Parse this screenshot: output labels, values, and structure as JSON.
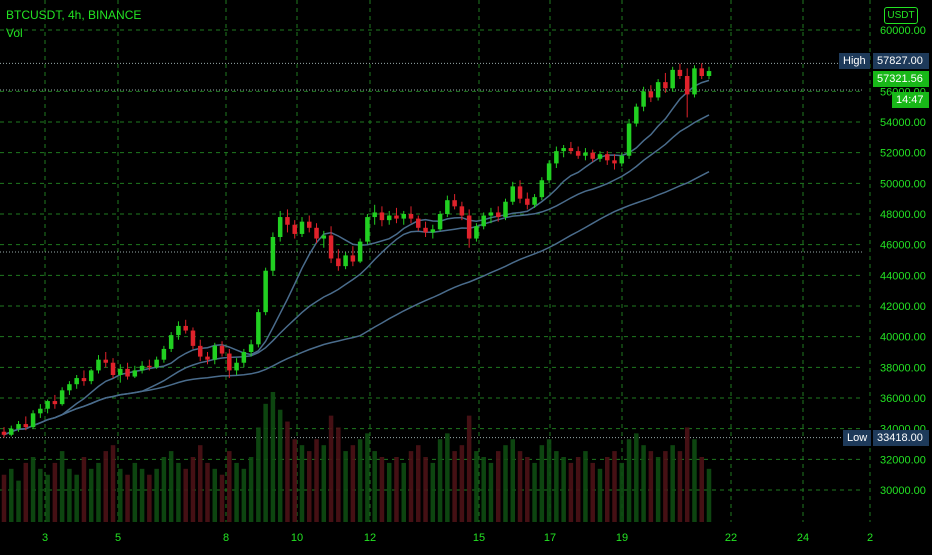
{
  "header": {
    "symbol_line": "BTCUSDT, 4h, BINANCE",
    "volume_label": "Vol"
  },
  "currency_button": "USDT",
  "labels": {
    "high_title": "High",
    "high_value": "57827.00",
    "last_price": "57321.56",
    "countdown": "14:47",
    "low_title": "Low",
    "low_value": "33418.00"
  },
  "colors": {
    "up": "#21d021",
    "down": "#e0222b",
    "ma": "#4a6c8c",
    "grid": "#1f7a1f",
    "text": "#23e323",
    "label_bg": "#1e3a5a",
    "price_bg": "#18b818"
  },
  "chart_data": {
    "type": "candlestick",
    "symbol": "BTCUSDT",
    "interval": "4h",
    "exchange": "BINANCE",
    "y_ticks": [
      "60000.00",
      "56000.00",
      "54000.00",
      "52000.00",
      "50000.00",
      "48000.00",
      "46000.00",
      "44000.00",
      "42000.00",
      "40000.00",
      "38000.00",
      "36000.00",
      "34000.00",
      "32000.00",
      "30000.00"
    ],
    "x_ticks": [
      "3",
      "5",
      "8",
      "10",
      "12",
      "15",
      "17",
      "19",
      "22",
      "24",
      "2"
    ],
    "ylim": [
      29000,
      61000
    ],
    "high": 57827.0,
    "low": 33418.0,
    "last": 57321.56,
    "ohlc": [
      [
        33800,
        34100,
        33420,
        33600
      ],
      [
        33600,
        34200,
        33500,
        34000
      ],
      [
        34000,
        34500,
        33800,
        34300
      ],
      [
        34300,
        34800,
        33900,
        34100
      ],
      [
        34100,
        35200,
        34000,
        35000
      ],
      [
        35000,
        35600,
        34700,
        35300
      ],
      [
        35300,
        35900,
        35000,
        35800
      ],
      [
        35800,
        36200,
        35300,
        35600
      ],
      [
        35600,
        36700,
        35500,
        36500
      ],
      [
        36500,
        37100,
        36200,
        36900
      ],
      [
        36900,
        37500,
        36600,
        37300
      ],
      [
        37300,
        37800,
        36800,
        37100
      ],
      [
        37100,
        37900,
        36900,
        37800
      ],
      [
        37800,
        38800,
        37600,
        38500
      ],
      [
        38500,
        39000,
        38000,
        38300
      ],
      [
        38300,
        38600,
        37300,
        37500
      ],
      [
        37500,
        38200,
        37000,
        37900
      ],
      [
        37900,
        38300,
        37200,
        37400
      ],
      [
        37400,
        38100,
        37300,
        37800
      ],
      [
        37800,
        38400,
        37600,
        38100
      ],
      [
        38100,
        38500,
        37800,
        38000
      ],
      [
        38000,
        38700,
        37900,
        38500
      ],
      [
        38500,
        39400,
        38300,
        39200
      ],
      [
        39200,
        40300,
        39000,
        40100
      ],
      [
        40100,
        41000,
        39800,
        40700
      ],
      [
        40700,
        41100,
        40200,
        40400
      ],
      [
        40400,
        40600,
        39200,
        39400
      ],
      [
        39400,
        39800,
        38400,
        38700
      ],
      [
        38700,
        39000,
        38200,
        38500
      ],
      [
        38500,
        39600,
        38200,
        39400
      ],
      [
        39400,
        39700,
        38700,
        38900
      ],
      [
        38900,
        39200,
        37300,
        37800
      ],
      [
        37800,
        38600,
        37500,
        38300
      ],
      [
        38300,
        39200,
        38000,
        39000
      ],
      [
        39000,
        39800,
        38700,
        39500
      ],
      [
        39500,
        41800,
        39300,
        41600
      ],
      [
        41600,
        44500,
        41400,
        44300
      ],
      [
        44300,
        46800,
        44000,
        46500
      ],
      [
        46500,
        48200,
        46200,
        47800
      ],
      [
        47800,
        48300,
        46800,
        47300
      ],
      [
        47300,
        47600,
        46400,
        46700
      ],
      [
        46700,
        47800,
        46500,
        47500
      ],
      [
        47500,
        47900,
        46800,
        47100
      ],
      [
        47100,
        47400,
        46100,
        46400
      ],
      [
        46400,
        46900,
        45800,
        46600
      ],
      [
        46600,
        47200,
        44800,
        45100
      ],
      [
        45100,
        45700,
        44300,
        44600
      ],
      [
        44600,
        45500,
        44400,
        45300
      ],
      [
        45300,
        45900,
        44600,
        44900
      ],
      [
        44900,
        46400,
        44800,
        46200
      ],
      [
        46200,
        48000,
        46000,
        47800
      ],
      [
        47800,
        48600,
        47300,
        48100
      ],
      [
        48100,
        48500,
        47200,
        47600
      ],
      [
        47600,
        48200,
        47300,
        47900
      ],
      [
        47900,
        48400,
        47400,
        47700
      ],
      [
        47700,
        48200,
        47300,
        48000
      ],
      [
        48000,
        48500,
        47400,
        47700
      ],
      [
        47700,
        47900,
        46900,
        47100
      ],
      [
        47100,
        47500,
        46500,
        46800
      ],
      [
        46800,
        47300,
        46400,
        47000
      ],
      [
        47000,
        48200,
        46900,
        48000
      ],
      [
        48000,
        49200,
        47800,
        48900
      ],
      [
        48900,
        49300,
        48300,
        48500
      ],
      [
        48500,
        48800,
        47600,
        47900
      ],
      [
        47900,
        48300,
        45800,
        46400
      ],
      [
        46400,
        47400,
        46200,
        47200
      ],
      [
        47200,
        48100,
        47000,
        47900
      ],
      [
        47900,
        48400,
        47400,
        48100
      ],
      [
        48100,
        48500,
        47500,
        47800
      ],
      [
        47800,
        49000,
        47600,
        48800
      ],
      [
        48800,
        50100,
        48600,
        49800
      ],
      [
        49800,
        50200,
        48700,
        49000
      ],
      [
        49000,
        49400,
        48300,
        48600
      ],
      [
        48600,
        49300,
        48400,
        49100
      ],
      [
        49100,
        50400,
        48900,
        50200
      ],
      [
        50200,
        51500,
        50000,
        51300
      ],
      [
        51300,
        52400,
        51000,
        52100
      ],
      [
        52100,
        52500,
        51700,
        52300
      ],
      [
        52300,
        52700,
        51900,
        52100
      ],
      [
        52100,
        52400,
        51600,
        51800
      ],
      [
        51800,
        52300,
        51500,
        52000
      ],
      [
        52000,
        52200,
        51400,
        51600
      ],
      [
        51600,
        52100,
        51400,
        51900
      ],
      [
        51900,
        52100,
        51200,
        51500
      ],
      [
        51500,
        51900,
        50900,
        51300
      ],
      [
        51300,
        52000,
        51100,
        51800
      ],
      [
        51800,
        54200,
        51600,
        53900
      ],
      [
        53900,
        55200,
        53700,
        55000
      ],
      [
        55000,
        56300,
        54700,
        56000
      ],
      [
        56000,
        56400,
        55300,
        55600
      ],
      [
        55600,
        56800,
        55400,
        56600
      ],
      [
        56600,
        57200,
        55900,
        56200
      ],
      [
        56200,
        57600,
        56000,
        57400
      ],
      [
        57400,
        57800,
        56800,
        57000
      ],
      [
        57000,
        57500,
        54300,
        55800
      ],
      [
        55800,
        57700,
        55600,
        57500
      ],
      [
        57500,
        57827,
        56800,
        57000
      ],
      [
        57000,
        57600,
        56800,
        57322
      ]
    ],
    "volume": [
      8,
      9,
      7,
      10,
      11,
      9,
      8,
      10,
      12,
      9,
      8,
      11,
      9,
      10,
      12,
      13,
      9,
      8,
      10,
      9,
      8,
      9,
      11,
      12,
      10,
      9,
      11,
      13,
      10,
      9,
      8,
      12,
      10,
      9,
      11,
      16,
      20,
      22,
      19,
      17,
      14,
      13,
      12,
      14,
      13,
      18,
      16,
      12,
      13,
      14,
      15,
      12,
      11,
      10,
      11,
      10,
      12,
      13,
      11,
      10,
      14,
      15,
      12,
      13,
      18,
      12,
      11,
      10,
      12,
      13,
      14,
      12,
      11,
      10,
      13,
      14,
      12,
      11,
      10,
      11,
      12,
      10,
      9,
      11,
      12,
      10,
      14,
      15,
      13,
      12,
      11,
      12,
      13,
      12,
      16,
      14,
      11,
      9
    ],
    "moving_averages": [
      {
        "period": 9
      },
      {
        "period": 20
      },
      {
        "period": 50
      }
    ]
  }
}
